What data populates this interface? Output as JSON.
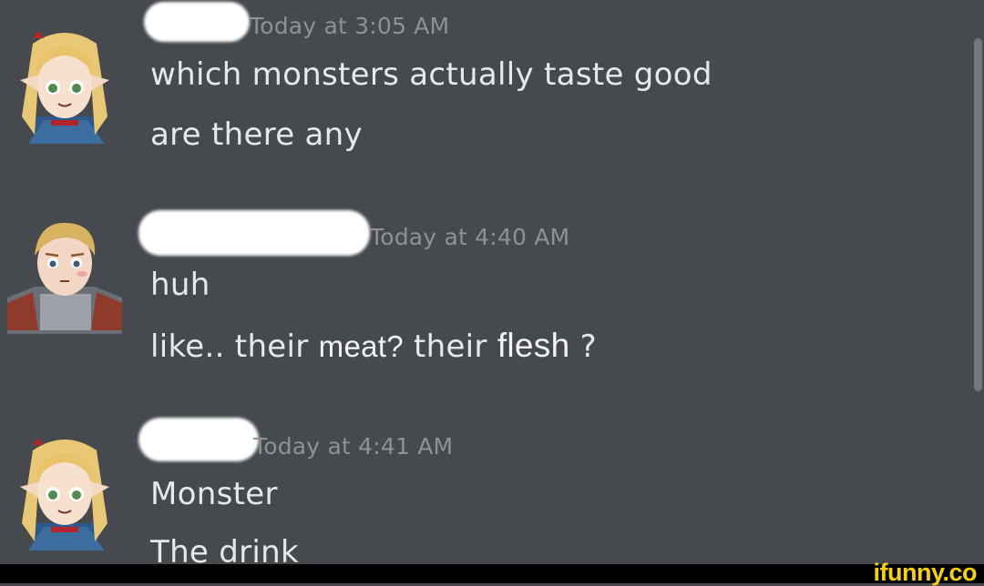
{
  "messages": [
    {
      "avatar_icon": "elf-girl-avatar-icon",
      "timestamp": "Today at 3:05 AM",
      "lines": [
        "which monsters actually taste good",
        "are there any"
      ]
    },
    {
      "avatar_icon": "blond-knight-avatar-icon",
      "timestamp": "Today at 4:40 AM",
      "lines": [
        "huh"
      ],
      "rich_line": {
        "part1": "like.. their ",
        "part2": "meat?",
        "part3": " their ",
        "part4": "flesh",
        "part5": " ?"
      }
    },
    {
      "avatar_icon": "elf-girl-avatar-icon",
      "timestamp": "Today at 4:41 AM",
      "lines": [
        "Monster",
        "The drink"
      ]
    }
  ],
  "watermark": "ifunny.co",
  "colors": {
    "background": "#464a4f",
    "message_text": "#e6e8ea",
    "timestamp": "#8e9297",
    "watermark": "#f7d200"
  }
}
